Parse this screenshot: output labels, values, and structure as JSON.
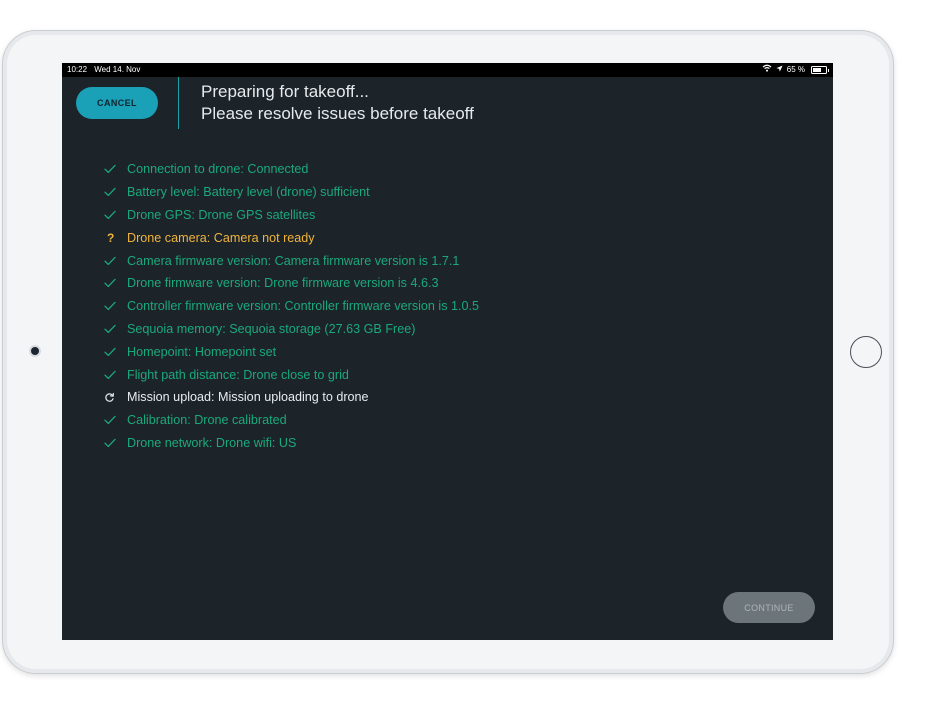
{
  "statusbar": {
    "time": "10:22",
    "date": "Wed 14. Nov",
    "battery_percent": "65 %",
    "battery_level": 0.65,
    "icons": [
      "wifi-icon",
      "location-arrow-icon",
      "battery-icon"
    ]
  },
  "header": {
    "cancel_label": "CANCEL",
    "title_line1": "Preparing for takeoff...",
    "title_line2": "Please resolve issues before takeoff"
  },
  "checklist": [
    {
      "status": "ok",
      "icon": "checkmark-icon",
      "text": "Connection to drone: Connected"
    },
    {
      "status": "ok",
      "icon": "checkmark-icon",
      "text": "Battery level: Battery level (drone) sufficient"
    },
    {
      "status": "ok",
      "icon": "checkmark-icon",
      "text": "Drone GPS: Drone GPS satellites"
    },
    {
      "status": "warn",
      "icon": "question-mark-icon",
      "glyph": "?",
      "text": "Drone camera: Camera not ready"
    },
    {
      "status": "ok",
      "icon": "checkmark-icon",
      "text": "Camera firmware version: Camera firmware version is 1.7.1"
    },
    {
      "status": "ok",
      "icon": "checkmark-icon",
      "text": "Drone firmware version: Drone firmware version is 4.6.3"
    },
    {
      "status": "ok",
      "icon": "checkmark-icon",
      "text": "Controller firmware version: Controller firmware version is 1.0.5"
    },
    {
      "status": "ok",
      "icon": "checkmark-icon",
      "text": "Sequoia memory: Sequoia storage (27.63 GB Free)"
    },
    {
      "status": "ok",
      "icon": "checkmark-icon",
      "text": "Homepoint: Homepoint set"
    },
    {
      "status": "ok",
      "icon": "checkmark-icon",
      "text": "Flight path distance: Drone close to grid"
    },
    {
      "status": "pending",
      "icon": "refresh-icon",
      "text": "Mission upload: Mission uploading to drone"
    },
    {
      "status": "ok",
      "icon": "checkmark-icon",
      "text": "Calibration: Drone calibrated"
    },
    {
      "status": "ok",
      "icon": "checkmark-icon",
      "text": "Drone network: Drone wifi: US"
    }
  ],
  "footer": {
    "continue_label": "CONTINUE",
    "continue_enabled": false
  },
  "colors": {
    "accent": "#1aa1b8",
    "ok": "#1ba97c",
    "warn": "#f0b43c",
    "pending": "#e8ecef",
    "background": "#1c2329"
  }
}
